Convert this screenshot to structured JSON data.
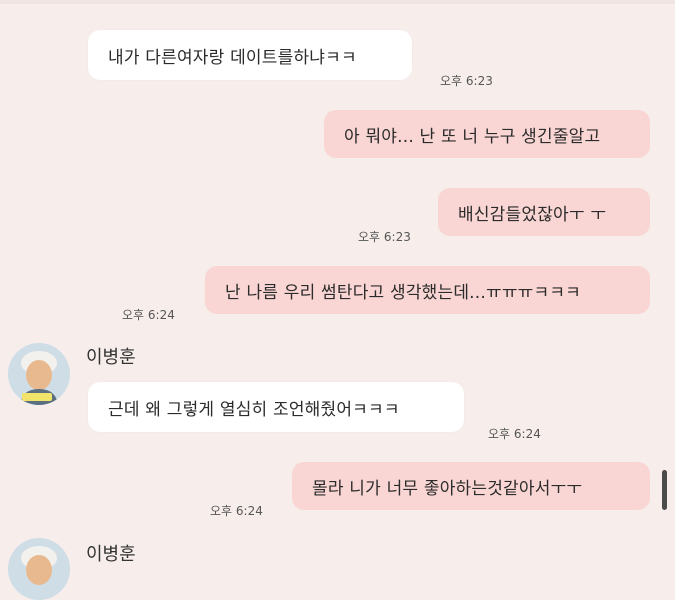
{
  "messages": [
    {
      "text": "내가 다른여자랑 데이트를하냐ㅋㅋ",
      "time": "오후 6:23"
    },
    {
      "text": "아 뭐야... 난 또 너 누구 생긴줄알고"
    },
    {
      "text": "배신감들었잖아ㅜ ㅜ",
      "time": "오후 6:23"
    },
    {
      "text": "난 나름 우리 썸탄다고 생각했는데...ㅠㅠㅠㅋㅋㅋ",
      "time": "오후 6:24"
    },
    {
      "text": "근데 왜 그렇게 열심히 조언해줬어ㅋㅋㅋ",
      "time": "오후 6:24"
    },
    {
      "text": "몰라 니가 너무 좋아하는것같아서ㅜㅜ",
      "time": "오후 6:24"
    }
  ],
  "contact": {
    "name": "이병훈",
    "avatar_icon": "person-avatar-icon"
  },
  "colors": {
    "background": "#f7eeec",
    "incoming": "#ffffff",
    "outgoing": "#f9d6d3"
  }
}
